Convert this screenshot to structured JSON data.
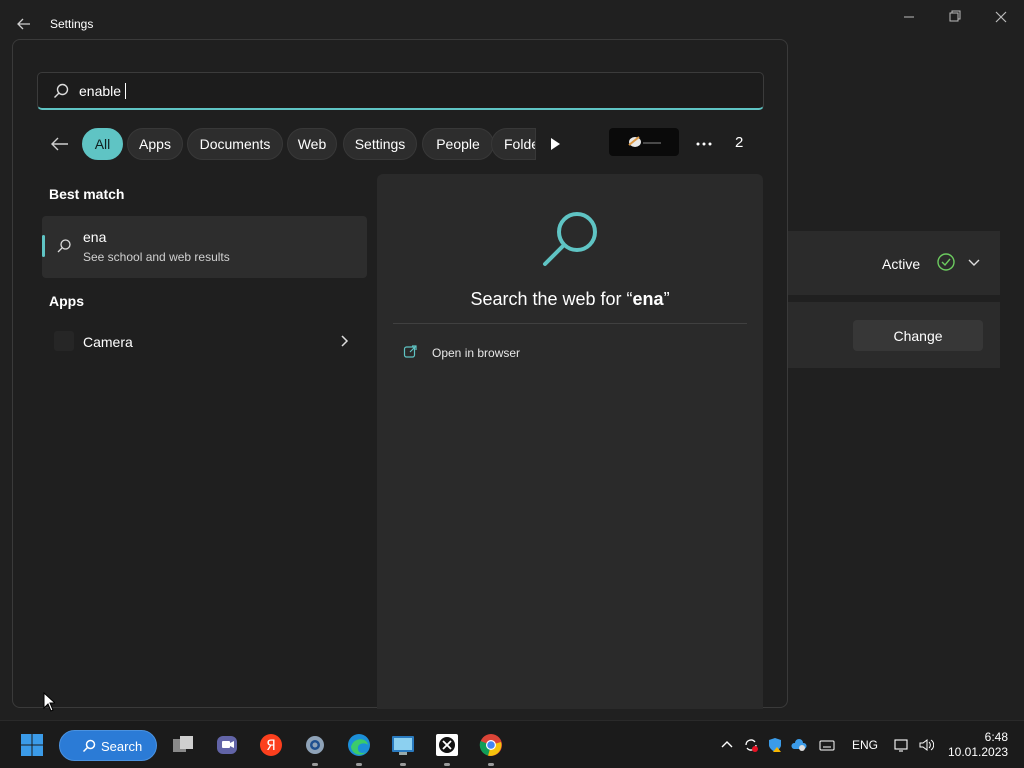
{
  "window": {
    "title": "Settings"
  },
  "settings_bg": {
    "status_text": "Active",
    "change_label": "Change"
  },
  "search": {
    "query": "enable",
    "filters": [
      "All",
      "Apps",
      "Documents",
      "Web",
      "Settings",
      "People",
      "Folders"
    ],
    "active_filter": "All",
    "result_count": "2"
  },
  "results": {
    "best_match_heading": "Best match",
    "best_match_title": "ena",
    "best_match_subtitle": "See school and web results",
    "apps_heading": "Apps",
    "app_items": [
      "Camera"
    ]
  },
  "preview": {
    "title_prefix": "Search the web for “",
    "title_query": "ena",
    "title_suffix": "”",
    "open_in_browser": "Open in browser"
  },
  "taskbar": {
    "search_label": "Search",
    "language": "ENG",
    "time": "6:48",
    "date": "10.01.2023"
  },
  "colors": {
    "accent": "#5fc4c4",
    "taskbar_search": "#2b7bd6",
    "check_green": "#6ccb5f"
  }
}
